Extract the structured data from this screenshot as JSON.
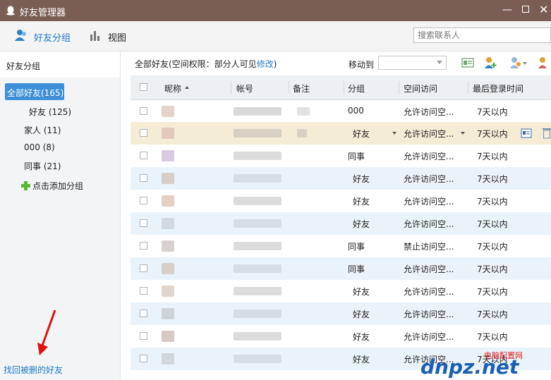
{
  "window": {
    "title": "好友管理器"
  },
  "toolbar": {
    "tab_groups": "好友分组",
    "tab_view": "视图",
    "search_placeholder": "搜索联系人"
  },
  "sidebar": {
    "header": "好友分组",
    "items": [
      {
        "label": "全部好友(165)",
        "selected": true
      },
      {
        "label": "好友 (125)"
      },
      {
        "label": "家人 (11)"
      },
      {
        "label": "000 (8)"
      },
      {
        "label": "同事 (21)"
      }
    ],
    "add_group": "点击添加分组",
    "restore_link": "找回被删的好友"
  },
  "main": {
    "scope_text": "全部好友(空间权限：部分人可见",
    "scope_edit": "修改",
    "scope_close": ")",
    "move_to_label": "移动到"
  },
  "table": {
    "columns": [
      "昵称",
      "帐号",
      "备注",
      "分组",
      "空间访问",
      "最后登录时间"
    ],
    "rows": [
      {
        "group": "000",
        "space": "允许访问空...",
        "last": "7天以内"
      },
      {
        "group": "好友",
        "space": "允许访问空...",
        "last": "7天以内"
      },
      {
        "group": "同事",
        "space": "允许访问空...",
        "last": "7天以内"
      },
      {
        "group": "好友",
        "space": "允许访问空...",
        "last": "7天以内"
      },
      {
        "group": "好友",
        "space": "允许访问空...",
        "last": "7天以内"
      },
      {
        "group": "好友",
        "space": "允许访问空...",
        "last": "7天以内"
      },
      {
        "group": "同事",
        "space": "禁止访问空...",
        "last": "7天以内"
      },
      {
        "group": "同事",
        "space": "允许访问空...",
        "last": "7天以内"
      },
      {
        "group": "好友",
        "space": "允许访问空...",
        "last": "7天以内"
      },
      {
        "group": "好友",
        "space": "允许访问空...",
        "last": "7天以内"
      },
      {
        "group": "好友",
        "space": "允许访问空...",
        "last": "7天以内"
      },
      {
        "group": "好友",
        "space": "允许访问空...",
        "last": "7天以内"
      }
    ]
  },
  "watermark": {
    "brand": "dnpz.net",
    "site": "电脑配置网"
  },
  "colors": {
    "titlebar": "#7a5e54",
    "selected": "#3e8fd8",
    "link": "#1f7bc9",
    "row_alt": "#ebf3fa",
    "row_highlight": "#f5ecd6"
  }
}
